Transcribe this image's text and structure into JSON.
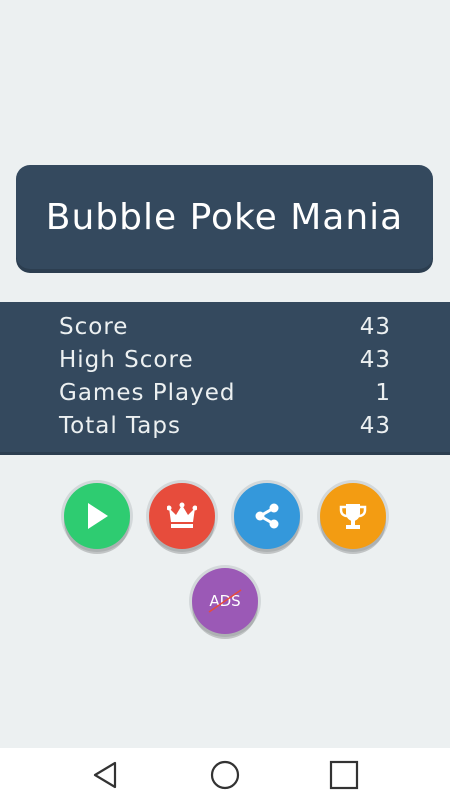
{
  "title": "Bubble Poke Mania",
  "stats": [
    {
      "label": "Score",
      "value": "43"
    },
    {
      "label": "High Score",
      "value": "43"
    },
    {
      "label": "Games Played",
      "value": "1"
    },
    {
      "label": "Total Taps",
      "value": "43"
    }
  ],
  "buttons": {
    "play": {
      "icon": "play-icon",
      "color": "#2ecc71"
    },
    "leaderboard": {
      "icon": "crown-icon",
      "color": "#e74c3c"
    },
    "share": {
      "icon": "share-icon",
      "color": "#3498db"
    },
    "achievements": {
      "icon": "trophy-icon",
      "color": "#f39c12"
    },
    "remove_ads": {
      "label": "ADS",
      "icon": "no-ads-icon",
      "color": "#9b59b6"
    }
  },
  "navbar": {
    "back": "back-triangle-icon",
    "home": "home-circle-icon",
    "recents": "recents-square-icon"
  },
  "colors": {
    "background": "#ecf0f1",
    "panel": "#34495e",
    "panel_shadow": "#2c3e50",
    "text_light": "#ffffff",
    "slash_red": "#e74c3c"
  }
}
